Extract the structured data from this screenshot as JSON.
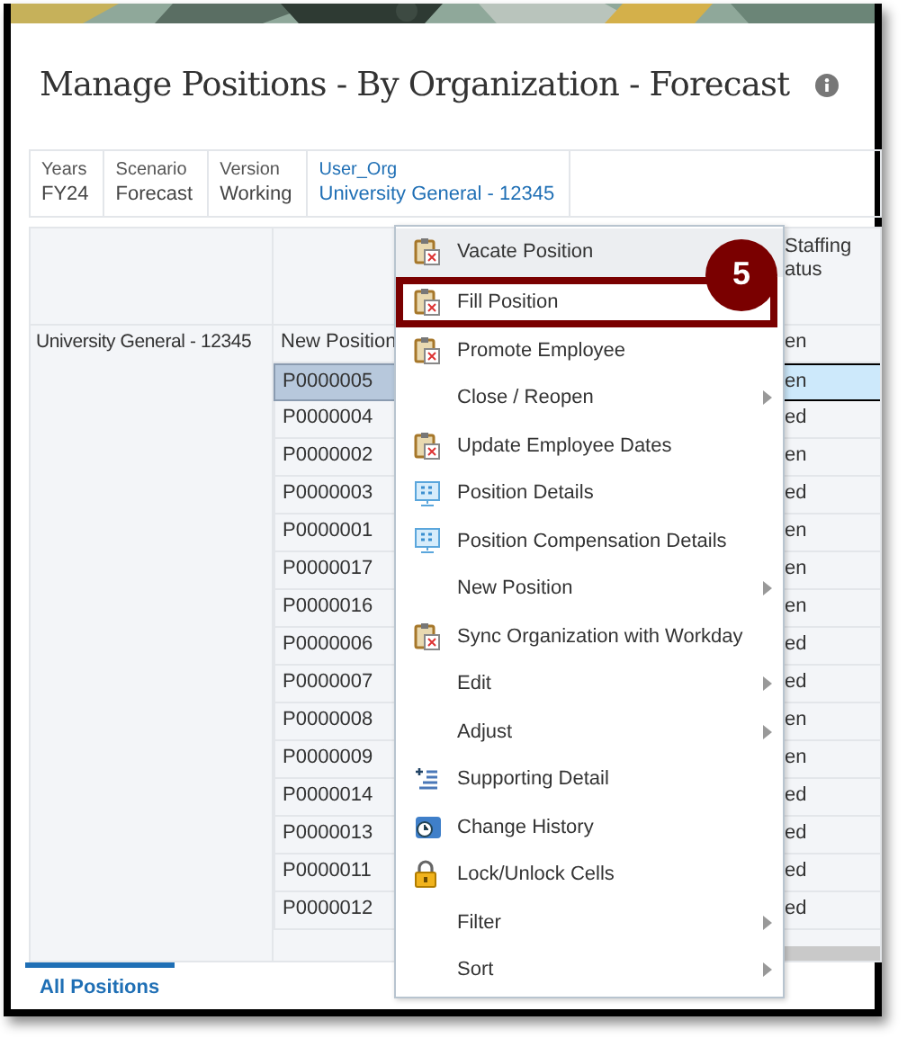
{
  "page": {
    "title": "Manage Positions - By Organization - Forecast"
  },
  "pov": [
    {
      "label": "Years",
      "value": "FY24",
      "link": false
    },
    {
      "label": "Scenario",
      "value": "Forecast",
      "link": false
    },
    {
      "label": "Version",
      "value": "Working",
      "link": false
    },
    {
      "label": "User_Org",
      "value": "University General - 12345",
      "link": true
    }
  ],
  "grid": {
    "staffing_header": [
      "Staffing",
      "atus"
    ],
    "organization": "University General - 12345",
    "rows": [
      {
        "position": "New Position",
        "staffing": "en",
        "selected": false
      },
      {
        "position": "P0000005",
        "staffing": "en",
        "selected": true
      },
      {
        "position": "P0000004",
        "staffing": "ed",
        "selected": false
      },
      {
        "position": "P0000002",
        "staffing": "en",
        "selected": false
      },
      {
        "position": "P0000003",
        "staffing": "ed",
        "selected": false
      },
      {
        "position": "P0000001",
        "staffing": "en",
        "selected": false
      },
      {
        "position": "P0000017",
        "staffing": "en",
        "selected": false
      },
      {
        "position": "P0000016",
        "staffing": "en",
        "selected": false
      },
      {
        "position": "P0000006",
        "staffing": "ed",
        "selected": false
      },
      {
        "position": "P0000007",
        "staffing": "ed",
        "selected": false
      },
      {
        "position": "P0000008",
        "staffing": "en",
        "selected": false
      },
      {
        "position": "P0000009",
        "staffing": "en",
        "selected": false
      },
      {
        "position": "P0000014",
        "staffing": "ed",
        "selected": false
      },
      {
        "position": "P0000013",
        "staffing": "ed",
        "selected": false
      },
      {
        "position": "P0000011",
        "staffing": "ed",
        "selected": false
      },
      {
        "position": "P0000012",
        "staffing": "ed",
        "selected": false
      }
    ]
  },
  "context_menu": {
    "items": [
      {
        "label": "Vacate Position",
        "kind": "clipboard",
        "submenu": false,
        "selected": true
      },
      {
        "label": "Fill Position",
        "kind": "clipboard",
        "submenu": false,
        "selected": false,
        "step": "5"
      },
      {
        "label": "Promote Employee",
        "kind": "clipboard",
        "submenu": false,
        "selected": false
      },
      {
        "label": "Close / Reopen",
        "kind": "plain",
        "submenu": true,
        "selected": false
      },
      {
        "label": "Update Employee Dates",
        "kind": "clipboard",
        "submenu": false,
        "selected": false
      },
      {
        "label": "Position Details",
        "kind": "monitor",
        "submenu": false,
        "selected": false
      },
      {
        "label": "Position Compensation Details",
        "kind": "monitor",
        "submenu": false,
        "selected": false
      },
      {
        "label": "New Position",
        "kind": "plain",
        "submenu": true,
        "selected": false
      },
      {
        "label": "Sync Organization with Workday",
        "kind": "clipboard",
        "submenu": false,
        "selected": false
      },
      {
        "label": "Edit",
        "kind": "plain",
        "submenu": true,
        "selected": false
      },
      {
        "label": "Adjust",
        "kind": "plain",
        "submenu": true,
        "selected": false
      },
      {
        "label": "Supporting Detail",
        "kind": "list",
        "submenu": false,
        "selected": false
      },
      {
        "label": "Change History",
        "kind": "clock",
        "submenu": false,
        "selected": false
      },
      {
        "label": "Lock/Unlock Cells",
        "kind": "lock",
        "submenu": false,
        "selected": false
      },
      {
        "label": "Filter",
        "kind": "plain",
        "submenu": true,
        "selected": false
      },
      {
        "label": "Sort",
        "kind": "plain",
        "submenu": true,
        "selected": false
      }
    ]
  },
  "tabs": [
    {
      "label": "All Positions",
      "selected": true
    }
  ]
}
